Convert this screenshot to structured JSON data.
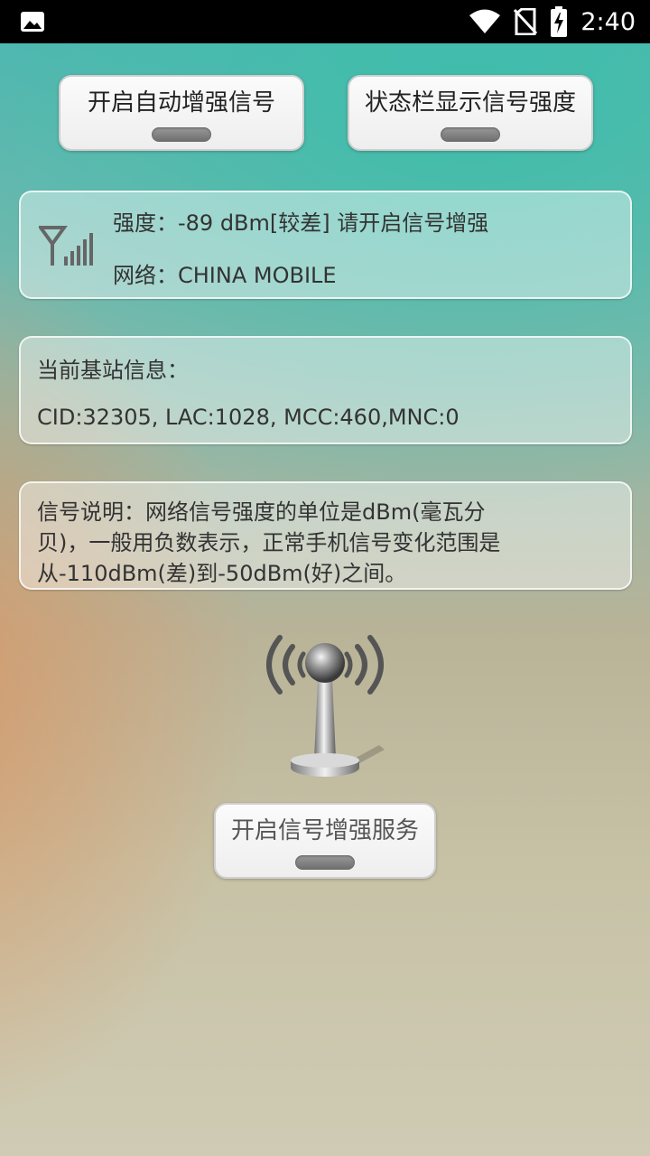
{
  "status_bar": {
    "time": "2:40",
    "icons": [
      "image-icon",
      "wifi-icon",
      "no-sim-icon",
      "battery-charging-icon"
    ]
  },
  "toggles": {
    "auto_boost": {
      "label": "开启自动增强信号"
    },
    "statusbar_show": {
      "label": "状态栏显示信号强度"
    }
  },
  "signal": {
    "icon": "signal-antenna-icon",
    "strength_line": "强度：-89 dBm[较差]  请开启信号增强",
    "network_line": "网络：CHINA MOBILE"
  },
  "base_station": {
    "title": "当前基站信息：",
    "info": "CID:32305, LAC:1028, MCC:460,MNC:0"
  },
  "note": {
    "line1": "信号说明：网络信号强度的单位是dBm(毫瓦分",
    "line2": "贝)，一般用负数表示，正常手机信号变化范围是",
    "line3": "从-110dBm(差)到-50dBm(好)之间。"
  },
  "service": {
    "label": "开启信号增强服务",
    "icon": "radio-tower-icon"
  }
}
